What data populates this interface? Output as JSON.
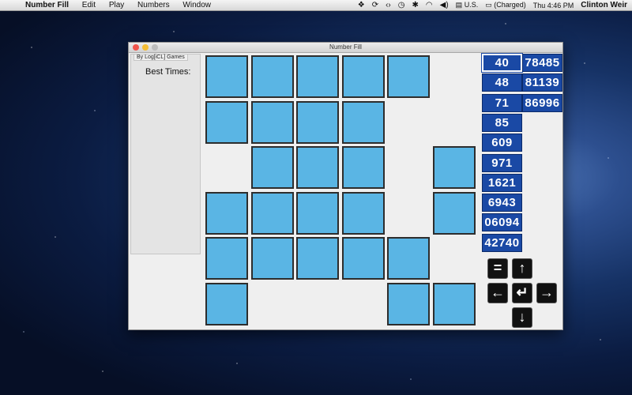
{
  "menubar": {
    "app_name": "Number Fill",
    "menus": [
      "Edit",
      "Play",
      "Numbers",
      "Window"
    ],
    "status": {
      "input_source": "U.S.",
      "battery": "(Charged)",
      "clock": "Thu 4:46 PM",
      "user": "Clinton Weir"
    }
  },
  "window": {
    "title": "Number Fill",
    "sidebar": {
      "tab_label": "By Log[iCL] Games",
      "best_times_label": "Best Times:"
    }
  },
  "grid": {
    "rows": [
      [
        1,
        1,
        1,
        1,
        1,
        0
      ],
      [
        1,
        1,
        1,
        1,
        0,
        0
      ],
      [
        0,
        1,
        1,
        1,
        0,
        1
      ],
      [
        1,
        1,
        1,
        1,
        0,
        1
      ],
      [
        1,
        1,
        1,
        1,
        1,
        0
      ],
      [
        1,
        0,
        0,
        0,
        1,
        1
      ]
    ]
  },
  "numbers": {
    "column1": [
      "40",
      "48",
      "71",
      "85",
      "609",
      "971",
      "1621",
      "6943",
      "06094",
      "42740"
    ],
    "column2": [
      "78485",
      "81139",
      "86996"
    ],
    "selected": "40"
  },
  "controls": {
    "equals_glyph": "=",
    "up_glyph": "↑",
    "left_glyph": "←",
    "enter_glyph": "↵",
    "right_glyph": "→",
    "down_glyph": "↓"
  },
  "colors": {
    "cell_fill": "#5ab5e4",
    "number_tile": "#1a49a5",
    "control_bg": "#111111"
  }
}
